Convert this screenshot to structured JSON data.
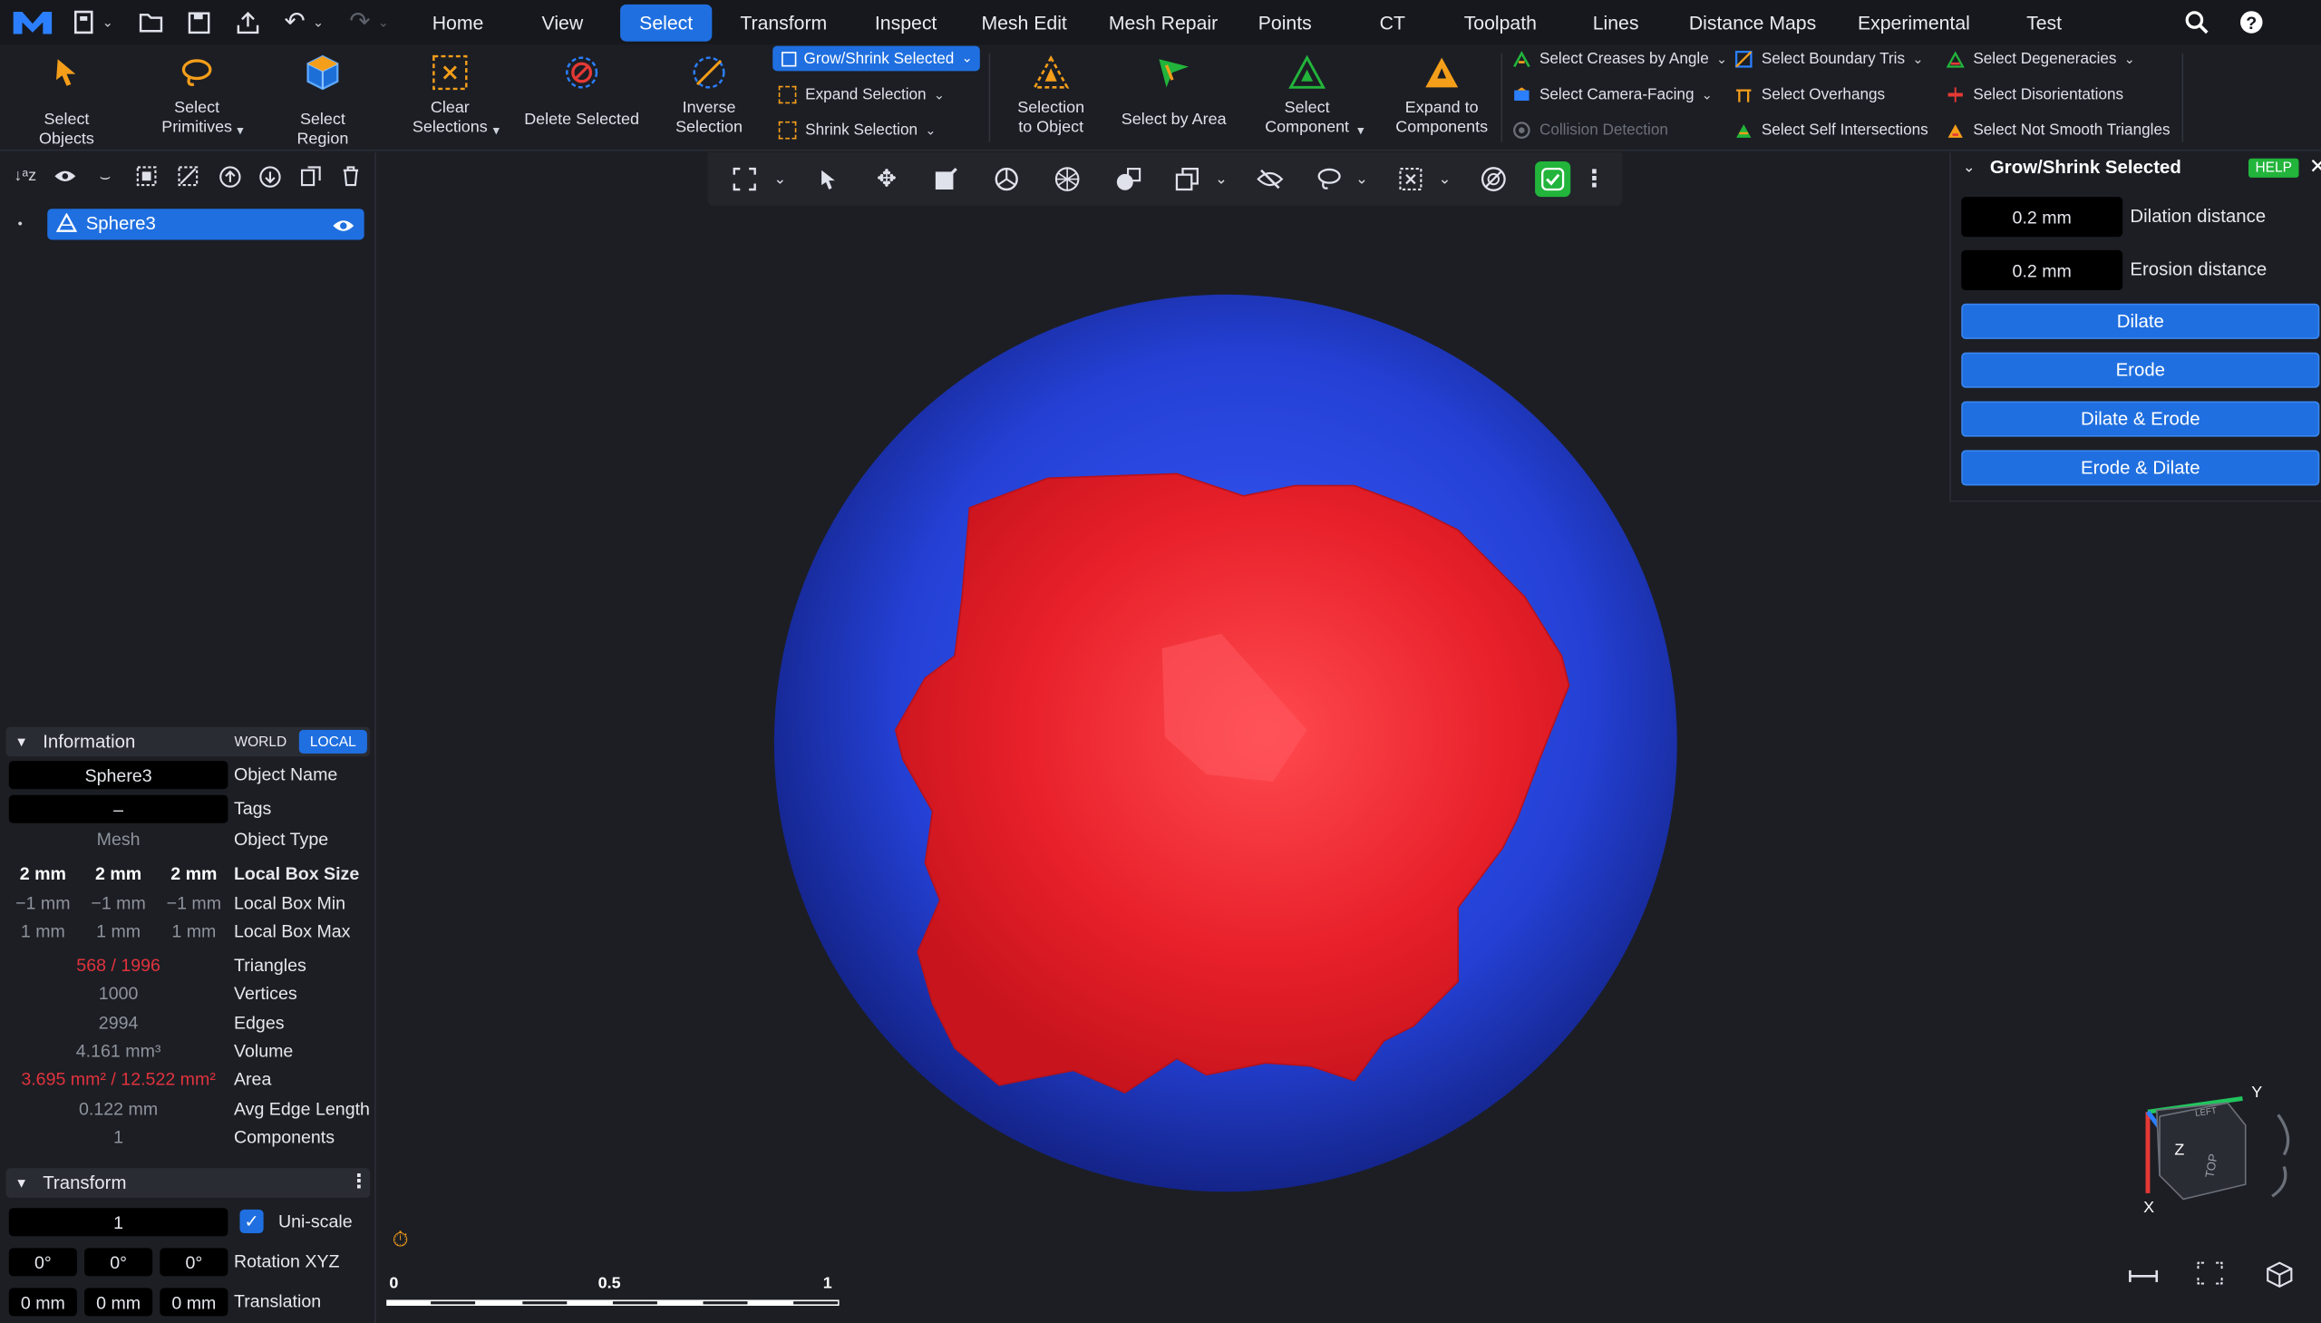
{
  "menubar": {
    "tabs": [
      "Home",
      "View",
      "Select",
      "Transform",
      "Inspect",
      "Mesh Edit",
      "Mesh Repair",
      "Points",
      "CT",
      "Toolpath",
      "Lines",
      "Distance Maps",
      "Experimental",
      "Test"
    ],
    "active": "Select"
  },
  "ribbon": {
    "select_objects": "Select Objects",
    "select_primitives": "Select\nPrimitives",
    "select_region": "Select Region",
    "clear_selections": "Clear\nSelections",
    "delete_selected": "Delete Selected",
    "inverse_selection": "Inverse\nSelection",
    "grow_shrink": "Grow/Shrink Selected",
    "expand_selection": "Expand Selection",
    "shrink_selection": "Shrink Selection",
    "selection_to_object": "Selection\nto Object",
    "select_by_area": "Select by Area",
    "select_component": "Select\nComponent",
    "expand_to_components": "Expand to\nComponents",
    "select_creases": "Select Creases by Angle",
    "select_camera_facing": "Select Camera-Facing",
    "collision_detection": "Collision Detection",
    "select_boundary_tris": "Select Boundary Tris",
    "select_overhangs": "Select Overhangs",
    "select_self_intersections": "Select Self Intersections",
    "select_degeneracies": "Select Degeneracies",
    "select_disorientations": "Select Disorientations",
    "select_not_smooth": "Select Not Smooth Triangles"
  },
  "tree": {
    "object": "Sphere3"
  },
  "information": {
    "title": "Information",
    "world": "WORLD",
    "local": "LOCAL",
    "object_name_value": "Sphere3",
    "object_name_label": "Object Name",
    "tags_value": "–",
    "tags_label": "Tags",
    "type_value": "Mesh",
    "type_label": "Object Type",
    "box_size": [
      "2 mm",
      "2 mm",
      "2 mm"
    ],
    "box_size_label": "Local Box Size",
    "box_min": [
      "−1 mm",
      "−1 mm",
      "−1 mm"
    ],
    "box_min_label": "Local Box Min",
    "box_max": [
      "1 mm",
      "1 mm",
      "1 mm"
    ],
    "box_max_label": "Local Box Max",
    "triangles_value": "568 / 1996",
    "triangles_label": "Triangles",
    "vertices_value": "1000",
    "vertices_label": "Vertices",
    "edges_value": "2994",
    "edges_label": "Edges",
    "volume_value": "4.161 mm³",
    "volume_label": "Volume",
    "area_value": "3.695 mm² / 12.522 mm²",
    "area_label": "Area",
    "avg_edge_value": "0.122 mm",
    "avg_edge_label": "Avg Edge Length",
    "components_value": "1",
    "components_label": "Components"
  },
  "transform": {
    "title": "Transform",
    "scale_value": "1",
    "uniscale_label": "Uni-scale",
    "rotation": [
      "0°",
      "0°",
      "0°"
    ],
    "rotation_label": "Rotation XYZ",
    "translation": [
      "0 mm",
      "0 mm",
      "0 mm"
    ],
    "translation_label": "Translation"
  },
  "grow_panel": {
    "title": "Grow/Shrink Selected",
    "help": "HELP",
    "dilation_value": "0.2 mm",
    "dilation_label": "Dilation distance",
    "erosion_value": "0.2 mm",
    "erosion_label": "Erosion distance",
    "buttons": [
      "Dilate",
      "Erode",
      "Dilate & Erode",
      "Erode & Dilate"
    ]
  },
  "scale_bar": {
    "labels": [
      "0",
      "0.5",
      "1"
    ]
  },
  "axes": {
    "x": "X",
    "y": "Y",
    "z": "Z",
    "cube_top": "TOP",
    "cube_left": "LEFT"
  },
  "colors": {
    "accent": "#1f6fe0",
    "selected_mesh": "#e8202a",
    "mesh": "#2a40d8",
    "highlight_text": "#e0333d",
    "confirm": "#22b43b"
  }
}
